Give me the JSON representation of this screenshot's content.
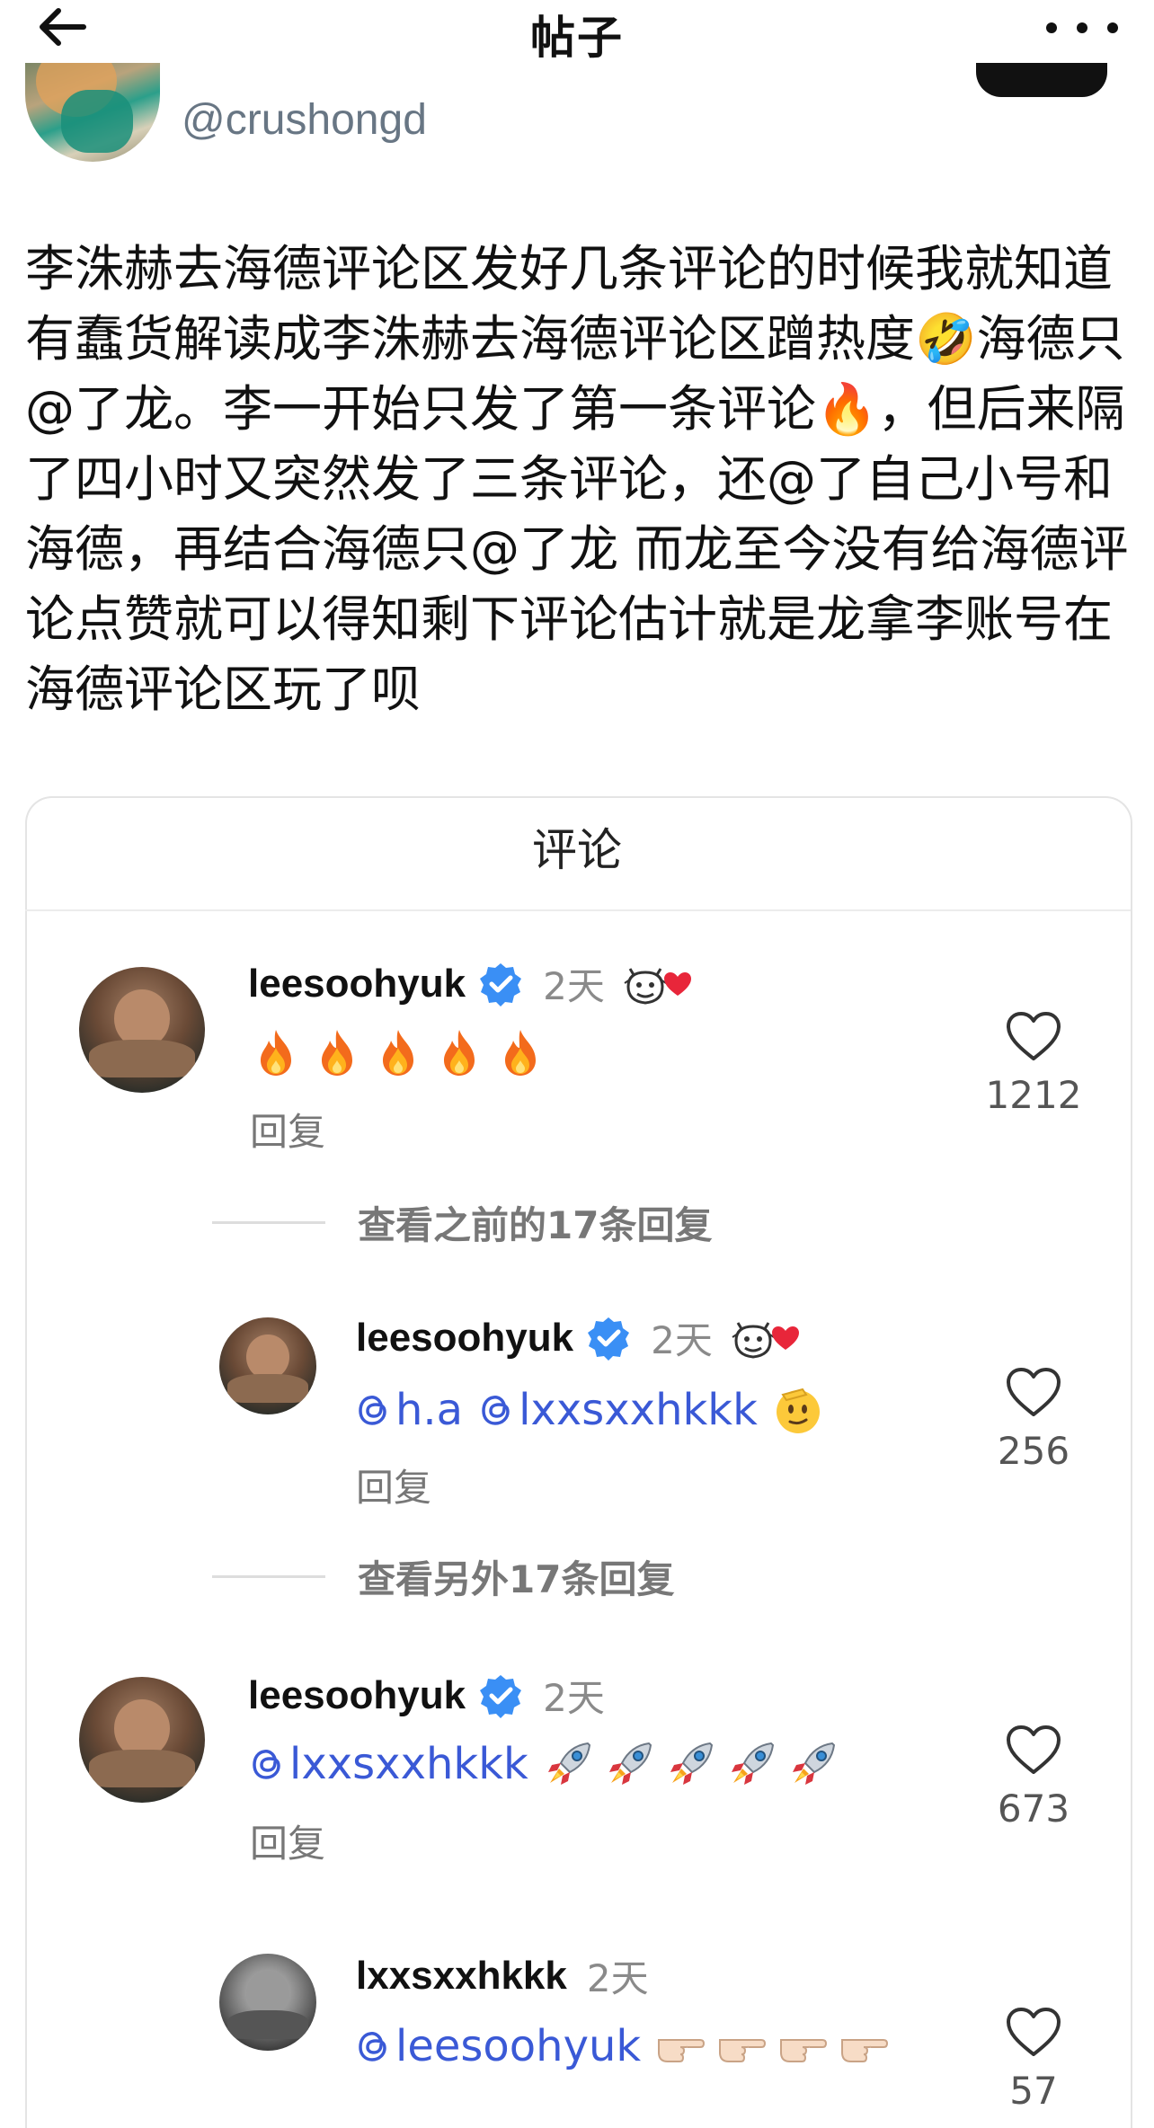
{
  "header": {
    "title": "帖子",
    "back_icon": "arrow-left-icon",
    "more_icon": "more-horizontal-icon"
  },
  "author": {
    "handle": "@crushongd"
  },
  "post": {
    "text": "李洙赫去海德评论区发好几条评论的时候我就知道有蠢货解读成李洙赫去海德评论区蹭热度🤣海德只@了龙。李一开始只发了第一条评论🔥，但后来隔了四小时又突然发了三条评论，还@了自己小号和海德，再结合海德只@了龙 而龙至今没有给海德评论点赞就可以得知剩下评论估计就是龙拿李账号在海德评论区玩了呗"
  },
  "comments_section": {
    "title": "评论",
    "items": [
      {
        "username": "leesoohyuk",
        "time": "2天",
        "verified": true,
        "author_liked": true,
        "text_emojis": [
          "fire",
          "fire",
          "fire",
          "fire",
          "fire"
        ],
        "reply_label": "回复",
        "likes": "1212"
      },
      {
        "more_label": "查看之前的17条回复"
      },
      {
        "username": "leesoohyuk",
        "time": "2天",
        "verified": true,
        "author_liked": true,
        "mention1": "h.a",
        "mention2": "lxxsxxhkkk",
        "text_emojis": [
          "saluting-face"
        ],
        "reply_label": "回复",
        "likes": "256"
      },
      {
        "more_label": "查看另外17条回复"
      },
      {
        "username": "leesoohyuk",
        "time": "2天",
        "verified": true,
        "author_liked": false,
        "mention1": "lxxsxxhkkk",
        "text_emojis": [
          "rocket",
          "rocket",
          "rocket",
          "rocket",
          "rocket"
        ],
        "reply_label": "回复",
        "likes": "673"
      },
      {
        "username": "lxxsxxhkkk",
        "time": "2天",
        "verified": false,
        "author_liked": false,
        "mention1": "leesoohyuk",
        "text_emojis": [
          "backhand-index-right",
          "backhand-index-right",
          "backhand-index-right",
          "backhand-index-right"
        ],
        "likes": "57"
      }
    ]
  },
  "colors": {
    "mention": "#3a59d6",
    "verified": "#3a8ff5",
    "muted": "#8a8a8a",
    "heart": "#e8263a"
  }
}
